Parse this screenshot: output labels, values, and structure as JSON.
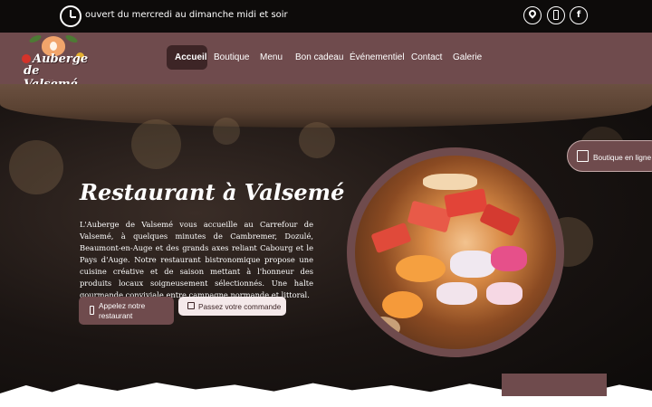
{
  "topbar": {
    "hours_text": "ouvert du mercredi au dimanche midi et soir",
    "icons": [
      "location-pin-icon",
      "phone-icon",
      "facebook-icon"
    ],
    "facebook_glyph": "f"
  },
  "logo": {
    "line1": "Auberge",
    "line2": "de Valsemé",
    "sub": "·· ··"
  },
  "nav": {
    "items": [
      "Accueil",
      "Boutique",
      "Menu",
      "Bon cadeau",
      "Événementiel",
      "Contact",
      "Galerie"
    ],
    "active": "Accueil"
  },
  "hero": {
    "title": "Restaurant à Valsemé",
    "body": "L'Auberge de Valsemé vous accueille au Carrefour de Valsemé, à quelques minutes de Cambremer, Dozulé, Beaumont-en-Auge et des grands axes reliant Cabourg et le Pays d'Auge. Notre restaurant bistronomique propose une cuisine créative et de saison mettant à l'honneur des produits locaux soigneusement sélectionnés. Une halte gourmande conviviale entre campagne normande et littoral.",
    "call_button": "Appelez notre restaurant",
    "order_button": "Passez votre commande"
  },
  "side_badge": {
    "label": "Boutique en ligne"
  },
  "colors": {
    "brand": "#6f4b4d",
    "nav_active": "#3d2526",
    "topbar": "#0d0b0a"
  }
}
